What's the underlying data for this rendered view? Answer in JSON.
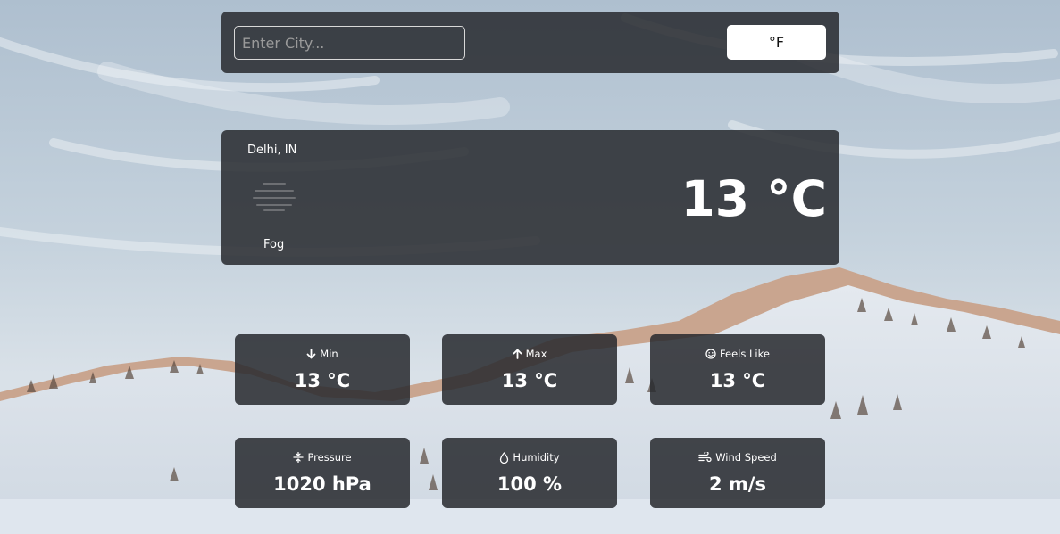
{
  "search": {
    "placeholder": "Enter City...",
    "value": "",
    "unit_toggle_label": "°F"
  },
  "current": {
    "city": "Delhi, IN",
    "condition": "Fog",
    "condition_icon": "fog-icon",
    "temperature": "13 °C"
  },
  "stats": {
    "min": {
      "label": "Min",
      "value": "13 °C",
      "icon": "arrow-down-icon"
    },
    "max": {
      "label": "Max",
      "value": "13 °C",
      "icon": "arrow-up-icon"
    },
    "feels_like": {
      "label": "Feels Like",
      "value": "13 °C",
      "icon": "smile-icon"
    },
    "pressure": {
      "label": "Pressure",
      "value": "1020 hPa",
      "icon": "pressure-icon"
    },
    "humidity": {
      "label": "Humidity",
      "value": "100 %",
      "icon": "droplet-icon"
    },
    "wind_speed": {
      "label": "Wind Speed",
      "value": "2 m/s",
      "icon": "wind-icon"
    }
  },
  "colors": {
    "panel": "#2a2c30",
    "text": "#ffffff",
    "button_bg": "#ffffff"
  }
}
